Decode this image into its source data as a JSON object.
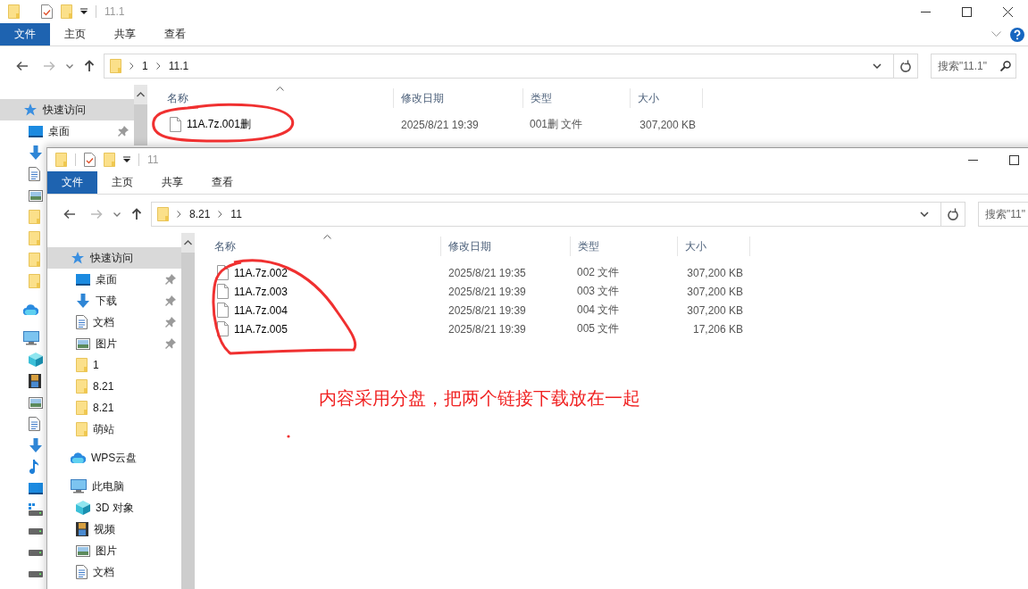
{
  "windows": [
    {
      "title": "11.1",
      "ribbon_tabs": [
        {
          "label": "文件",
          "selected": true
        },
        {
          "label": "主页",
          "selected": false
        },
        {
          "label": "共享",
          "selected": false
        },
        {
          "label": "查看",
          "selected": false
        }
      ],
      "path": [
        "1",
        "11.1"
      ],
      "search": {
        "placeholder": "搜索\"11.1\""
      },
      "nav_pane": [
        {
          "label": "快速访问",
          "selected": true,
          "children": [
            {
              "label": "桌面",
              "pinned": true
            }
          ]
        }
      ],
      "columns": [
        "名称",
        "修改日期",
        "类型",
        "大小"
      ],
      "files": [
        {
          "name": "11A.7z.001删",
          "modified": "2025/8/21 19:39",
          "type": "001删 文件",
          "size": "307,200 KB"
        }
      ]
    },
    {
      "title": "11",
      "ribbon_tabs": [
        {
          "label": "文件",
          "selected": true
        },
        {
          "label": "主页",
          "selected": false
        },
        {
          "label": "共享",
          "selected": false
        },
        {
          "label": "查看",
          "selected": false
        }
      ],
      "path": [
        "8.21",
        "11"
      ],
      "search": {
        "placeholder": "搜索\"11\""
      },
      "nav_pane": [
        {
          "label": "快速访问",
          "selected": true,
          "children": [
            {
              "label": "桌面",
              "pinned": true
            },
            {
              "label": "下载",
              "pinned": true
            },
            {
              "label": "文档",
              "pinned": true
            },
            {
              "label": "图片",
              "pinned": true
            },
            {
              "label": "1",
              "pinned": false
            },
            {
              "label": "8.21",
              "pinned": false
            },
            {
              "label": "8.21",
              "pinned": false
            },
            {
              "label": "萌站",
              "pinned": false
            }
          ]
        },
        {
          "label": "WPS云盘",
          "selected": false
        },
        {
          "label": "此电脑",
          "selected": false,
          "children": [
            {
              "label": "3D 对象"
            },
            {
              "label": "视频"
            },
            {
              "label": "图片"
            },
            {
              "label": "文档"
            }
          ]
        }
      ],
      "columns": [
        "名称",
        "修改日期",
        "类型",
        "大小"
      ],
      "files": [
        {
          "name": "11A.7z.002",
          "modified": "2025/8/21 19:35",
          "type": "002 文件",
          "size": "307,200 KB"
        },
        {
          "name": "11A.7z.003",
          "modified": "2025/8/21 19:39",
          "type": "003 文件",
          "size": "307,200 KB"
        },
        {
          "name": "11A.7z.004",
          "modified": "2025/8/21 19:39",
          "type": "004 文件",
          "size": "307,200 KB"
        },
        {
          "name": "11A.7z.005",
          "modified": "2025/8/21 19:39",
          "type": "005 文件",
          "size": "17,206 KB"
        }
      ]
    }
  ],
  "annotation": {
    "note": "内容采用分盘，把两个链接下载放在一起"
  }
}
